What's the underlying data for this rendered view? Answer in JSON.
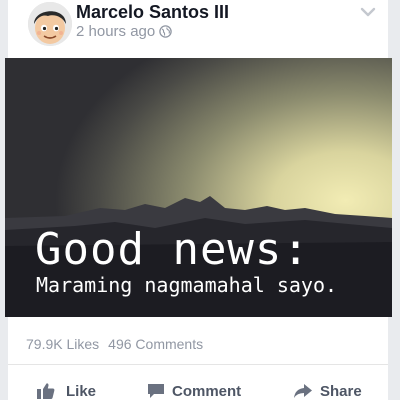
{
  "post": {
    "author": "Marcelo Santos III",
    "time": "2 hours ago",
    "image_headline": "Good news:",
    "image_subline": "Maraming nagmamahal sayo.",
    "likes": "79.9K Likes",
    "comments": "496 Comments"
  },
  "actions": {
    "like": "Like",
    "comment": "Comment",
    "share": "Share"
  },
  "icons": {
    "globe": "globe-icon",
    "chevron": "chevron-down-icon",
    "like": "thumbs-up-icon",
    "comment": "speech-bubble-icon",
    "share": "share-arrow-icon"
  },
  "colors": {
    "accent_text": "#4e5665",
    "muted": "#9197a3",
    "background": "#e9ebee"
  }
}
